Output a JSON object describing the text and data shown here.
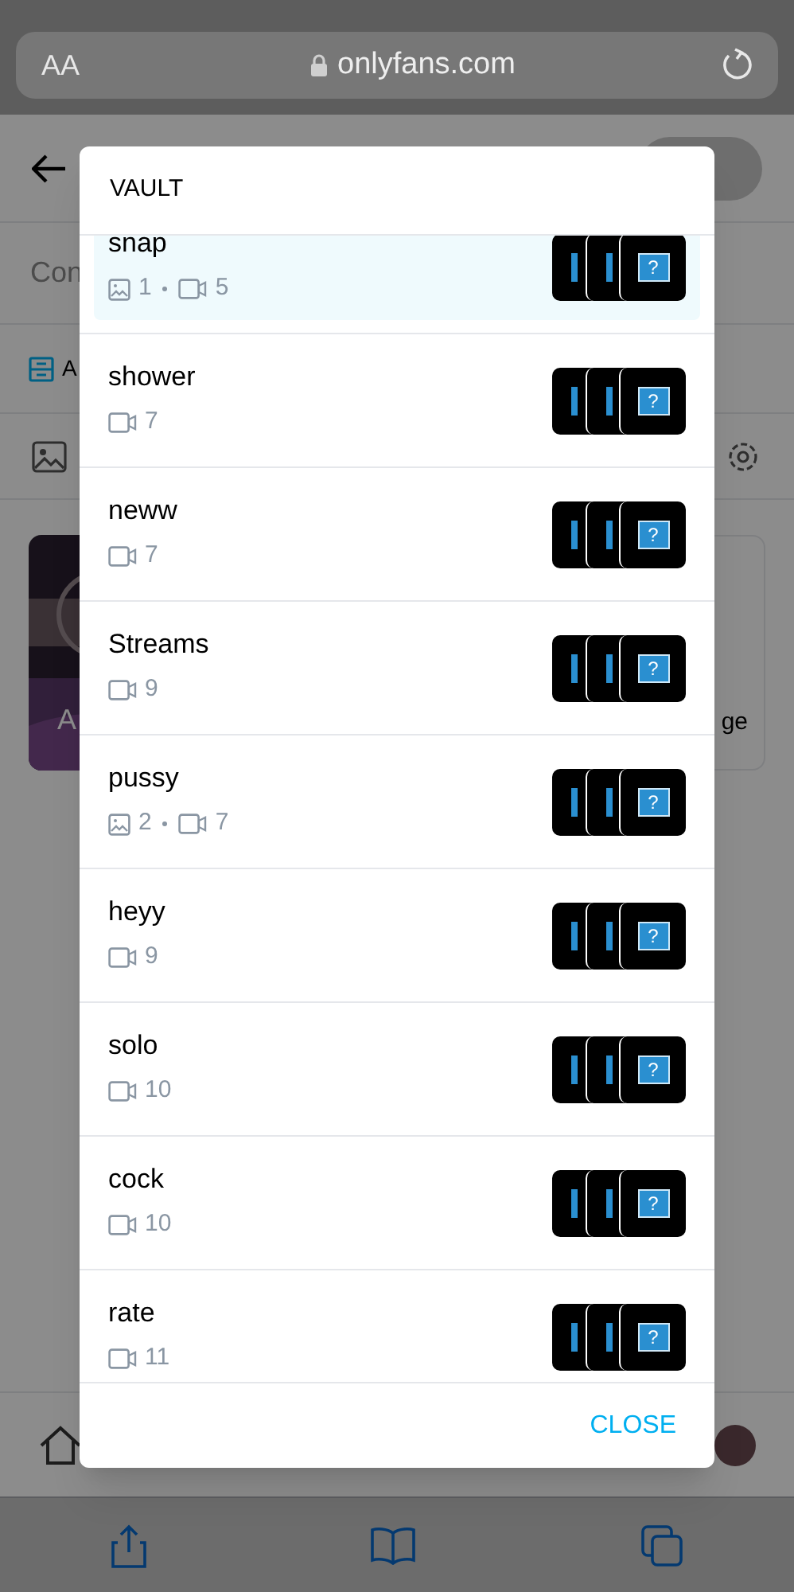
{
  "browser": {
    "text_size": "AA",
    "url": "onlyfans.com"
  },
  "page": {
    "subtitle": "Con",
    "section": "A",
    "card_left": "A",
    "card_right": "ge"
  },
  "vault": {
    "title": "VAULT",
    "close": "CLOSE",
    "folders": [
      {
        "name": "snap",
        "photos": "1",
        "videos": "5",
        "selected": true,
        "thumb": "?"
      },
      {
        "name": "shower",
        "videos": "7",
        "selected": false,
        "thumb": "?"
      },
      {
        "name": "neww",
        "videos": "7",
        "selected": false,
        "thumb": "?"
      },
      {
        "name": "Streams",
        "videos": "9",
        "selected": false,
        "thumb": "?"
      },
      {
        "name": "pussy",
        "photos": "2",
        "videos": "7",
        "selected": false,
        "thumb": "?"
      },
      {
        "name": "heyy",
        "videos": "9",
        "selected": false,
        "thumb": "?"
      },
      {
        "name": "solo",
        "videos": "10",
        "selected": false,
        "thumb": "?"
      },
      {
        "name": "cock",
        "videos": "10",
        "selected": false,
        "thumb": "?"
      },
      {
        "name": "rate",
        "videos": "11",
        "selected": false,
        "thumb": "?"
      }
    ]
  }
}
